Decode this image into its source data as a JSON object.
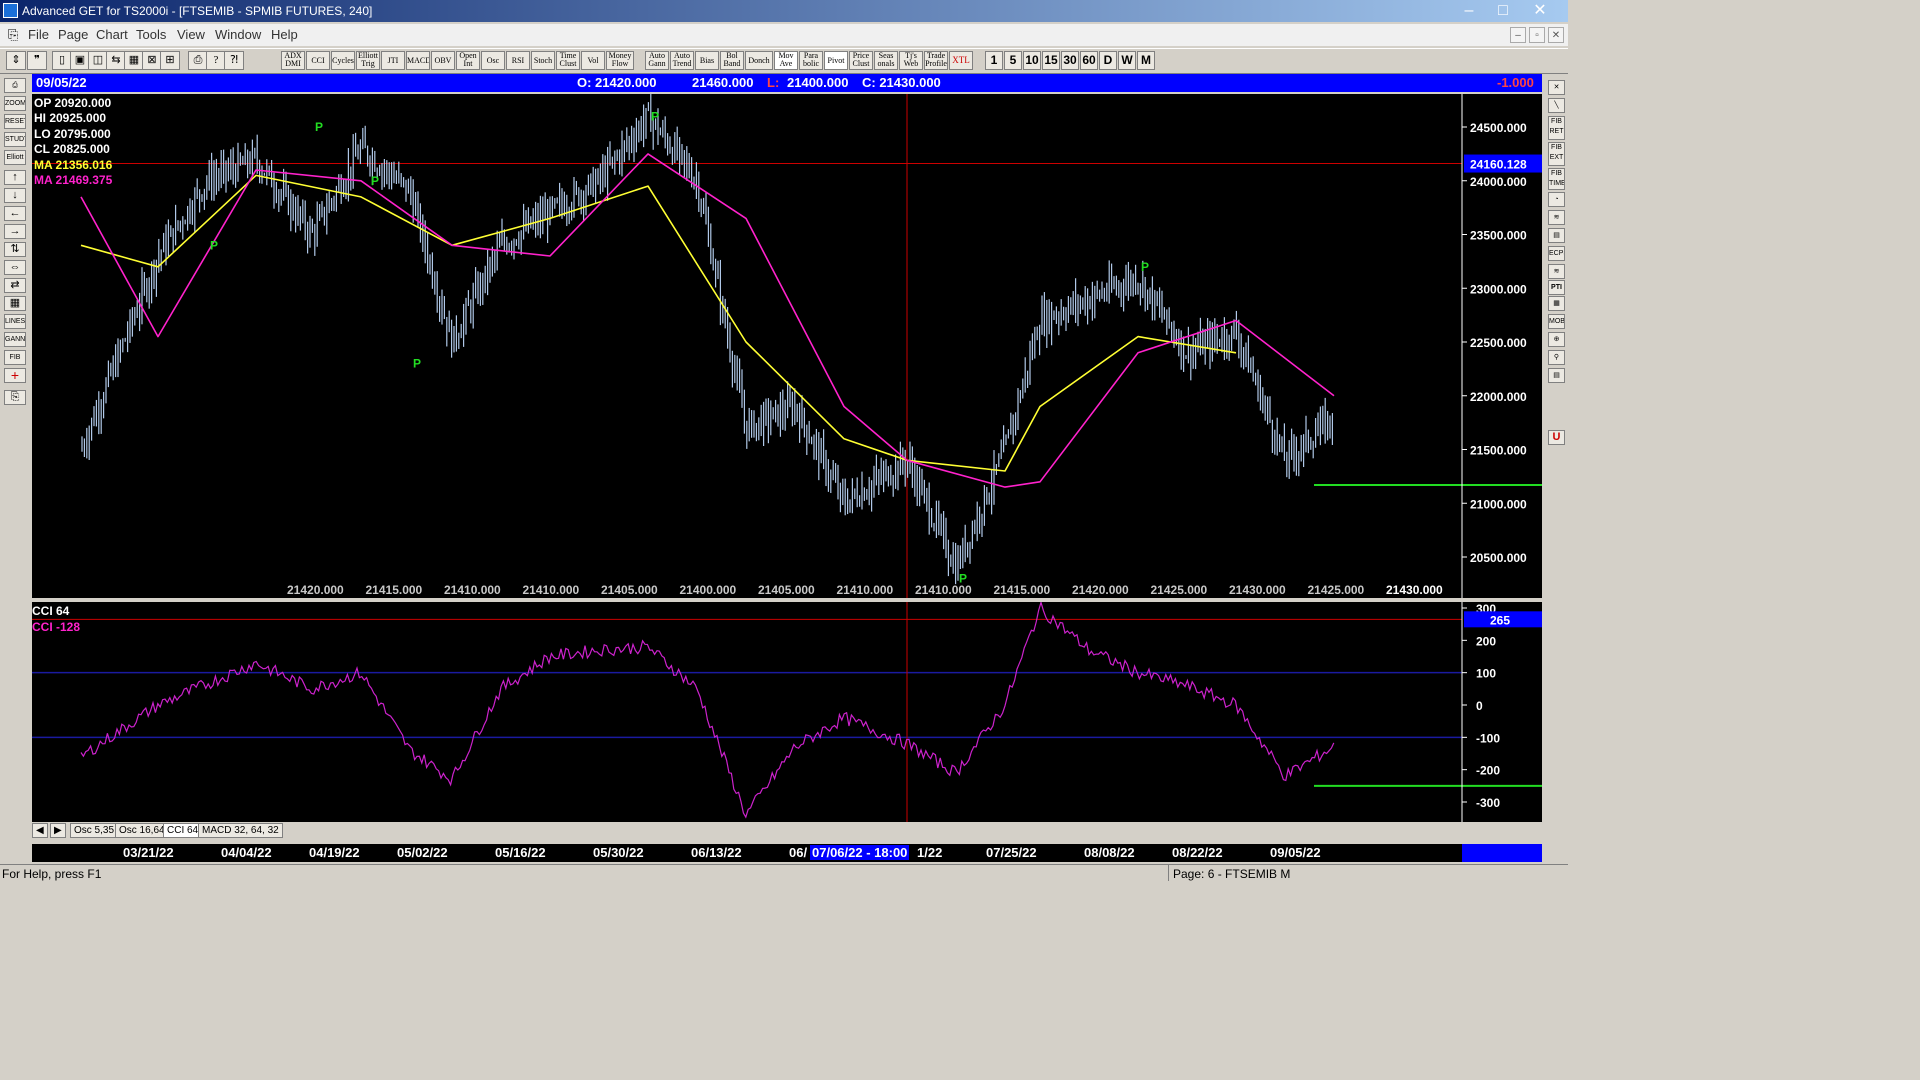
{
  "window": {
    "title": "Advanced GET for TS2000i - [FTSEMIB - SPMIB FUTURES, 240]",
    "minimize": "–",
    "maximize": "□",
    "close": "✕"
  },
  "menu": [
    "File",
    "Page",
    "Chart",
    "Tools",
    "View",
    "Window",
    "Help"
  ],
  "mdi_buttons": [
    "–",
    "▫",
    "✕"
  ],
  "toolbar": {
    "file_tools": [
      "⇕",
      "❞",
      "▯",
      "▣",
      "◫",
      "⇆",
      "▦",
      "⊠",
      "⊞",
      "⎙",
      "?",
      "⁈"
    ],
    "studies": [
      "ADX DMI",
      "CCI",
      "Cycles",
      "Elliott Trig",
      "JTI",
      "MACD",
      "OBV",
      "Open Int",
      "Osc",
      "RSI",
      "Stoch",
      "Time Clust",
      "Vol",
      "Money Flow",
      "Auto Gann",
      "Auto Trend",
      "Bias",
      "Bol Band",
      "Donch",
      "Mov Ave",
      "Para bolic",
      "Pivot",
      "Price Clust",
      "Seas onals",
      "Tj's Web",
      "Trade Profile",
      "XTL"
    ],
    "timeframes": [
      "1",
      "5",
      "10",
      "15",
      "30",
      "60",
      "D",
      "W",
      "M"
    ]
  },
  "left_tools": [
    "⎙",
    "ZOOM",
    "RESET",
    "STUDY",
    "Elliott",
    "↑",
    "↓",
    "←",
    "→",
    "⇅",
    "⇔",
    "⇄",
    "▦",
    "LINES",
    "GANN",
    "FIB",
    "+",
    "⎘"
  ],
  "right_tools": [
    "✕",
    "╲",
    "FIB RET",
    "FIB EXT",
    "FIB TIME",
    "◔",
    "≋",
    "▤",
    "ECPS",
    "≋",
    "PTI",
    "▦",
    "MOB",
    "⊕",
    "⚲",
    "▤",
    "U"
  ],
  "infobar": {
    "date": "09/05/22",
    "open": "O: 21420.000",
    "high": "21460.000",
    "low_prefix": "L:",
    "low": "21400.000",
    "close": "C: 21430.000",
    "change": "-1.000"
  },
  "price_panel": {
    "legend": {
      "op": "OP  20920.000",
      "hi": "HI   20925.000",
      "lo": "LO  20795.000",
      "cl": "CL  20825.000",
      "ma1": "MA  21356.016",
      "ma2": "MA  21469.375"
    },
    "cursor_price": "24160.128",
    "pivot_marker": "P",
    "bottom_scale": [
      "21420.000",
      "21415.000",
      "21410.000",
      "21410.000",
      "21405.000",
      "21400.000",
      "21405.000",
      "21410.000",
      "21410.000",
      "21415.000",
      "21420.000",
      "21425.000",
      "21430.000",
      "21425.000",
      "21430.000"
    ],
    "colors": {
      "bars": "#b0c8e8",
      "ma_fast": "#ffff33",
      "ma_slow": "#ff22cc",
      "cursor": "#cc0000",
      "target": "#22dd22",
      "pivot": "#22dd22"
    }
  },
  "cci_panel": {
    "title": "CCI 64",
    "value_label": "CCI  -128",
    "cursor_value": "265",
    "colors": {
      "line": "#cc22cc",
      "band": "#1a1aa0",
      "cursor": "#cc0000",
      "target": "#22dd22"
    }
  },
  "tabs": [
    "Osc 5,35",
    "Osc 16,64",
    "CCI 64",
    "MACD 32, 64, 32"
  ],
  "tab_nav": [
    "◀",
    "▶"
  ],
  "date_axis": {
    "dates": [
      "03/21/22",
      "04/04/22",
      "04/19/22",
      "05/02/22",
      "05/16/22",
      "05/30/22",
      "06/13/22",
      "06/",
      "1/22",
      "07/25/22",
      "08/08/22",
      "08/22/22",
      "09/05/22"
    ],
    "cursor_date": "07/06/22 - 18:00"
  },
  "status": {
    "help": "For Help, press F1",
    "page": "Page: 6 - FTSEMIB M"
  },
  "chart_data": [
    {
      "type": "ohlc",
      "title": "FTSEMIB - SPMIB FUTURES, 240",
      "xlabel": "",
      "ylabel": "",
      "x_ticks": [
        "03/21/22",
        "04/04/22",
        "04/19/22",
        "05/02/22",
        "05/16/22",
        "05/30/22",
        "06/13/22",
        "07/25/22",
        "08/08/22",
        "08/22/22",
        "09/05/22"
      ],
      "y_ticks": [
        24500,
        24000,
        23500,
        23000,
        22500,
        22000,
        21500,
        21000,
        20500
      ],
      "ylim": [
        20200,
        24800
      ],
      "grid": false,
      "series": [
        {
          "name": "",
          "kind": "close",
          "x": [
            "03/10/22",
            "03/21/22",
            "03/28/22",
            "04/04/22",
            "04/12/22",
            "04/19/22",
            "04/26/22",
            "05/02/22",
            "05/09/22",
            "05/16/22",
            "05/23/22",
            "05/30/22",
            "06/06/22",
            "06/13/22",
            "06/20/22",
            "06/27/22",
            "07/06/22",
            "07/13/22",
            "07/20/22",
            "07/25/22",
            "08/01/22",
            "08/08/22",
            "08/15/22",
            "08/22/22",
            "08/29/22",
            "09/05/22"
          ],
          "values": [
            21500,
            23300,
            24000,
            24200,
            23500,
            24300,
            23900,
            22500,
            23400,
            23700,
            24000,
            24600,
            24000,
            21700,
            21900,
            21000,
            21400,
            20400,
            21500,
            22700,
            22900,
            23100,
            22400,
            22600,
            21400,
            21800
          ]
        },
        {
          "name": "MA",
          "kind": "ma_fast",
          "x": [
            "03/10/22",
            "03/21/22",
            "04/04/22",
            "04/19/22",
            "05/02/22",
            "05/16/22",
            "05/30/22",
            "06/13/22",
            "06/27/22",
            "07/06/22",
            "07/20/22",
            "07/25/22",
            "08/08/22",
            "08/22/22"
          ],
          "values": [
            23400,
            23200,
            24050,
            23850,
            23400,
            23650,
            23950,
            22500,
            21600,
            21400,
            21300,
            21900,
            22550,
            22400
          ]
        },
        {
          "name": "MA",
          "kind": "ma_slow",
          "x": [
            "03/10/22",
            "03/21/22",
            "04/04/22",
            "04/19/22",
            "05/02/22",
            "05/16/22",
            "05/30/22",
            "06/13/22",
            "06/27/22",
            "07/06/22",
            "07/20/22",
            "07/25/22",
            "08/08/22",
            "08/22/22",
            "09/05/22"
          ],
          "values": [
            23850,
            22550,
            24100,
            24000,
            23400,
            23300,
            24250,
            23650,
            21900,
            21400,
            21150,
            21200,
            22400,
            22700,
            22000
          ]
        }
      ],
      "pivots": [
        [
          "03/29/22",
          23400,
          "P"
        ],
        [
          "04/13/22",
          24500,
          "P"
        ],
        [
          "04/21/22",
          24000,
          "P"
        ],
        [
          "04/27/22",
          22300,
          "P"
        ],
        [
          "05/31/22",
          24600,
          "P"
        ],
        [
          "07/14/22",
          20300,
          "P"
        ],
        [
          "08/09/22",
          23200,
          "P"
        ]
      ],
      "cursor_value": 24160.128,
      "target_level": 21170
    },
    {
      "type": "line",
      "title": "CCI 64",
      "xlabel": "",
      "ylabel": "",
      "y_ticks": [
        300,
        200,
        100,
        0,
        -100,
        -200,
        -300
      ],
      "ylim": [
        -350,
        310
      ],
      "bands": [
        100,
        -100
      ],
      "series": [
        {
          "name": "CCI",
          "x": [
            "03/10/22",
            "03/21/22",
            "04/04/22",
            "04/12/22",
            "04/19/22",
            "04/26/22",
            "05/02/22",
            "05/09/22",
            "05/16/22",
            "05/23/22",
            "05/30/22",
            "06/06/22",
            "06/13/22",
            "06/20/22",
            "06/27/22",
            "07/06/22",
            "07/13/22",
            "07/20/22",
            "07/25/22",
            "08/01/22",
            "08/08/22",
            "08/15/22",
            "08/22/22",
            "08/29/22",
            "09/05/22"
          ],
          "values": [
            -160,
            0,
            130,
            50,
            100,
            -140,
            -230,
            50,
            150,
            170,
            180,
            50,
            -340,
            -130,
            -40,
            -120,
            -210,
            0,
            300,
            170,
            100,
            60,
            0,
            -220,
            -128
          ]
        }
      ],
      "cursor_value": 265,
      "target_level": -250
    }
  ]
}
